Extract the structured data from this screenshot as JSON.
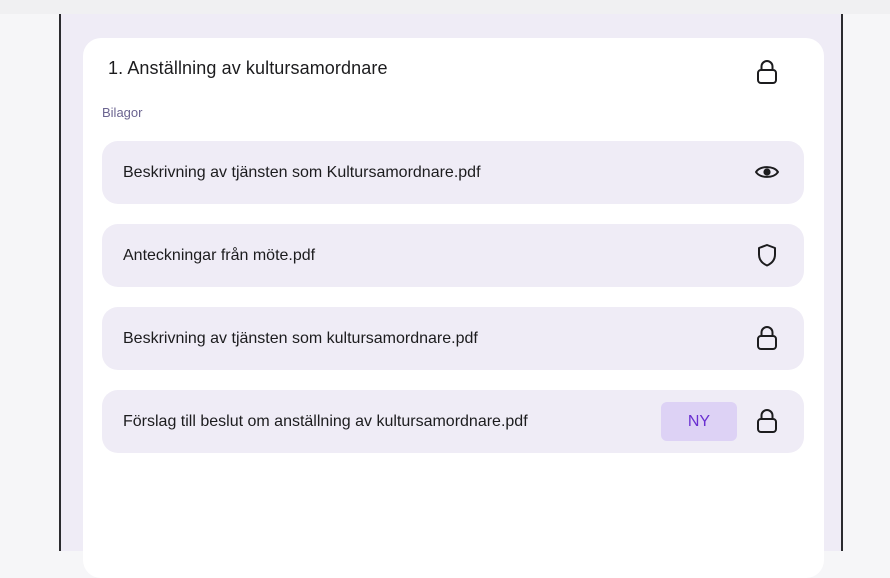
{
  "agenda_item": {
    "title": "1. Anställning av kultursamordnare",
    "lock_icon": "lock-icon"
  },
  "attachments_section": {
    "label": "Bilagor"
  },
  "attachments": [
    {
      "name": "Beskrivning av tjänsten som Kultursamordnare.pdf",
      "icon": "eye-icon",
      "badge": ""
    },
    {
      "name": "Anteckningar från möte.pdf",
      "icon": "shield-icon",
      "badge": ""
    },
    {
      "name": "Beskrivning av tjänsten som kultursamordnare.pdf",
      "icon": "lock-icon",
      "badge": ""
    },
    {
      "name": "Förslag till beslut om anställning av kultursamordnare.pdf",
      "icon": "lock-icon",
      "badge": "NY"
    }
  ],
  "colors": {
    "background": "#efecf6",
    "card": "#ffffff",
    "badge_bg": "#ddd2f5",
    "badge_text": "#6a2fd1",
    "label": "#6b6490"
  }
}
